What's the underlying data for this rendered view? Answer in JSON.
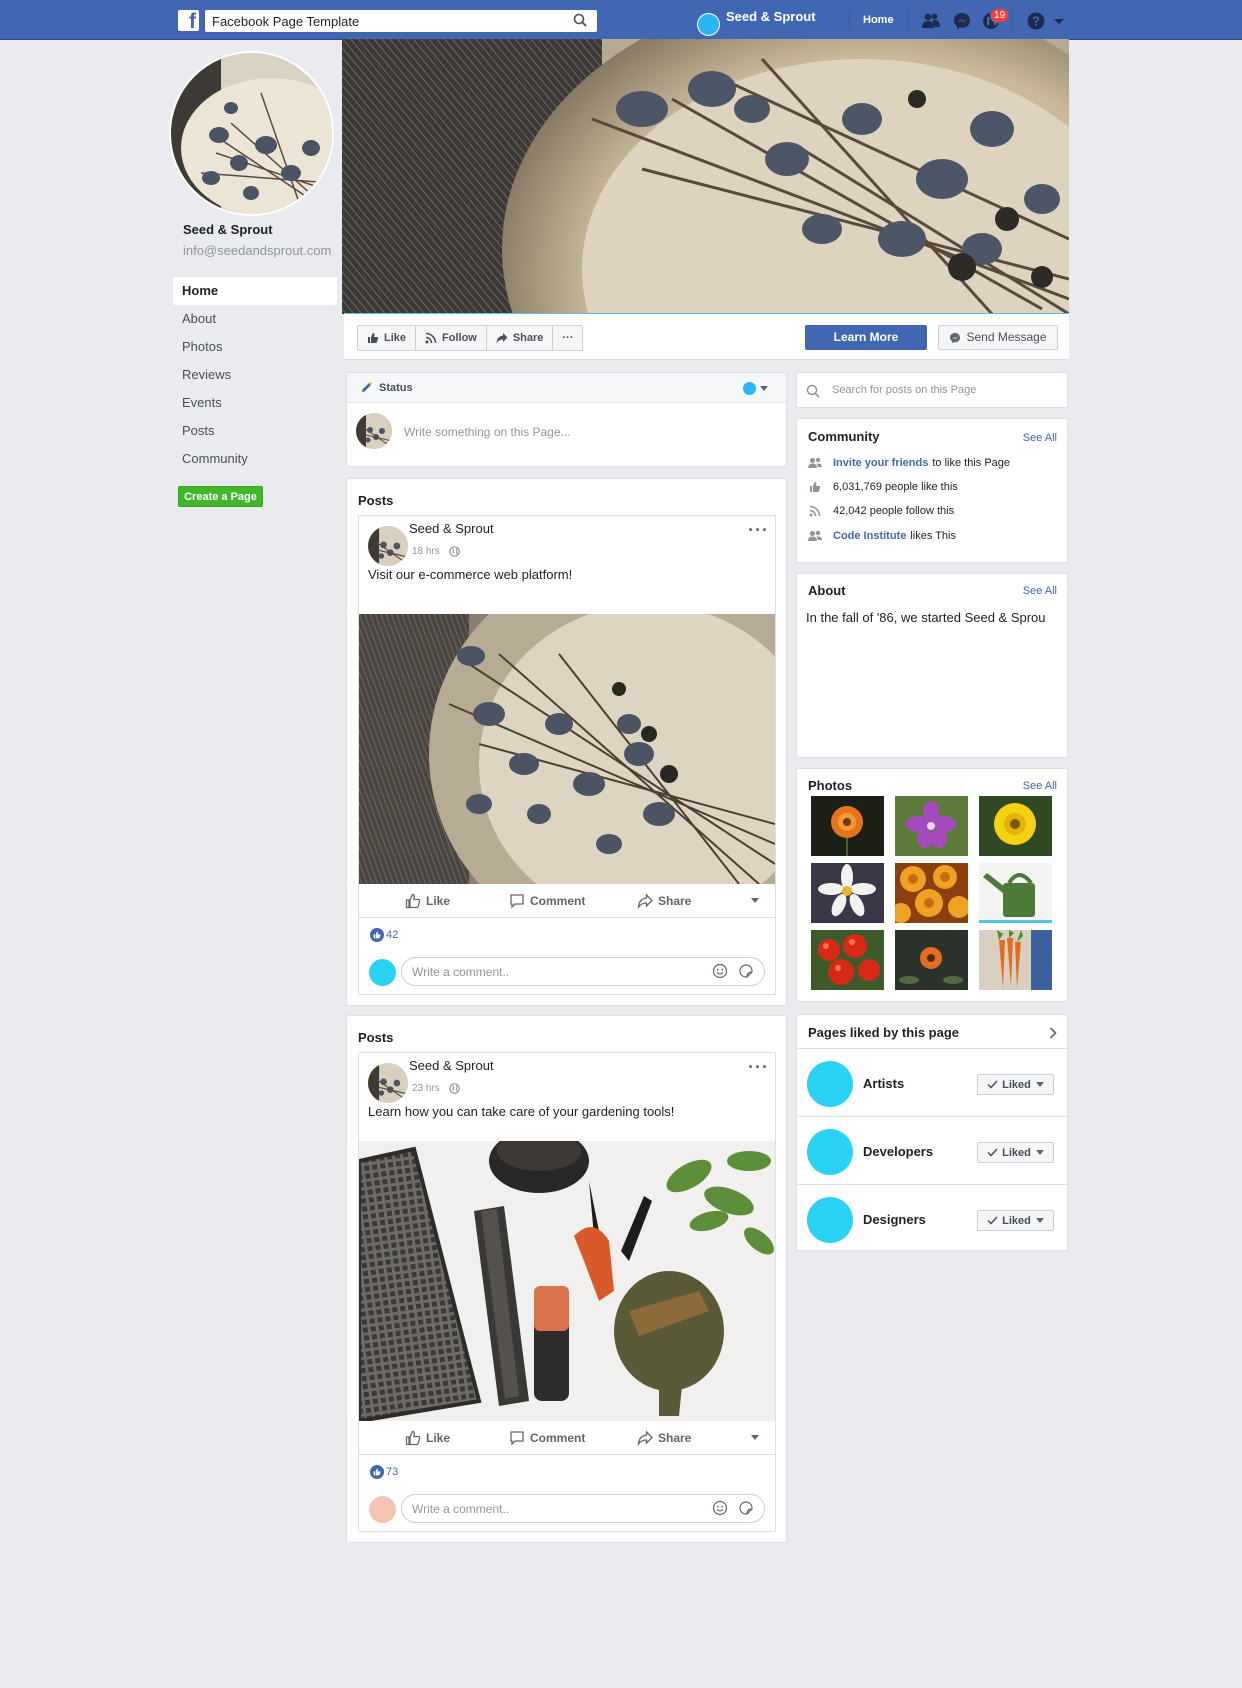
{
  "topbar": {
    "search_value": "Facebook Page Template",
    "profile_name": "Seed & Sprout",
    "home_label": "Home",
    "notification_count": "19",
    "brand_color": "#4267b2"
  },
  "sidebar": {
    "page_name": "Seed & Sprout",
    "email": "info@seedandsprout.com",
    "items": [
      {
        "label": "Home"
      },
      {
        "label": "About"
      },
      {
        "label": "Photos"
      },
      {
        "label": "Reviews"
      },
      {
        "label": "Events"
      },
      {
        "label": "Posts"
      },
      {
        "label": "Community"
      }
    ],
    "create_page_label": "Create a Page"
  },
  "action_bar": {
    "like": "Like",
    "follow": "Follow",
    "share": "Share",
    "more": "···",
    "learn_more": "Learn More",
    "send_message": "Send Message"
  },
  "status": {
    "label": "Status",
    "placeholder": "Write something on this Page..."
  },
  "posts": [
    {
      "section_title": "Posts",
      "author": "Seed & Sprout",
      "time": "18 hrs",
      "text": "Visit our e-commerce web platform!",
      "like_label": "Like",
      "comment_label": "Comment",
      "share_label": "Share",
      "likes": "42",
      "comment_placeholder": "Write a comment.."
    },
    {
      "section_title": "Posts",
      "author": "Seed & Sprout",
      "time": "23 hrs",
      "text": "Learn how you can take care of your gardening tools!",
      "like_label": "Like",
      "comment_label": "Comment",
      "share_label": "Share",
      "likes": "73",
      "comment_placeholder": "Write a comment.."
    }
  ],
  "right": {
    "search_placeholder": "Search for posts on this Page",
    "community": {
      "title": "Community",
      "see_all": "See All",
      "invite_link": "Invite your friends",
      "invite_rest": "to like this Page",
      "likes_text": "6,031,769 people like this",
      "follows_text": "42,042 people follow this",
      "liker_link": "Code Institute",
      "liker_rest": "likes This"
    },
    "about": {
      "title": "About",
      "see_all": "See All",
      "text": "In the fall of '86, we started Seed & Sprou"
    },
    "photos": {
      "title": "Photos",
      "see_all": "See All"
    },
    "pages_liked": {
      "title": "Pages liked by this page",
      "button_label": "Liked",
      "pages": [
        {
          "name": "Artists"
        },
        {
          "name": "Developers"
        },
        {
          "name": "Designers"
        }
      ]
    }
  }
}
